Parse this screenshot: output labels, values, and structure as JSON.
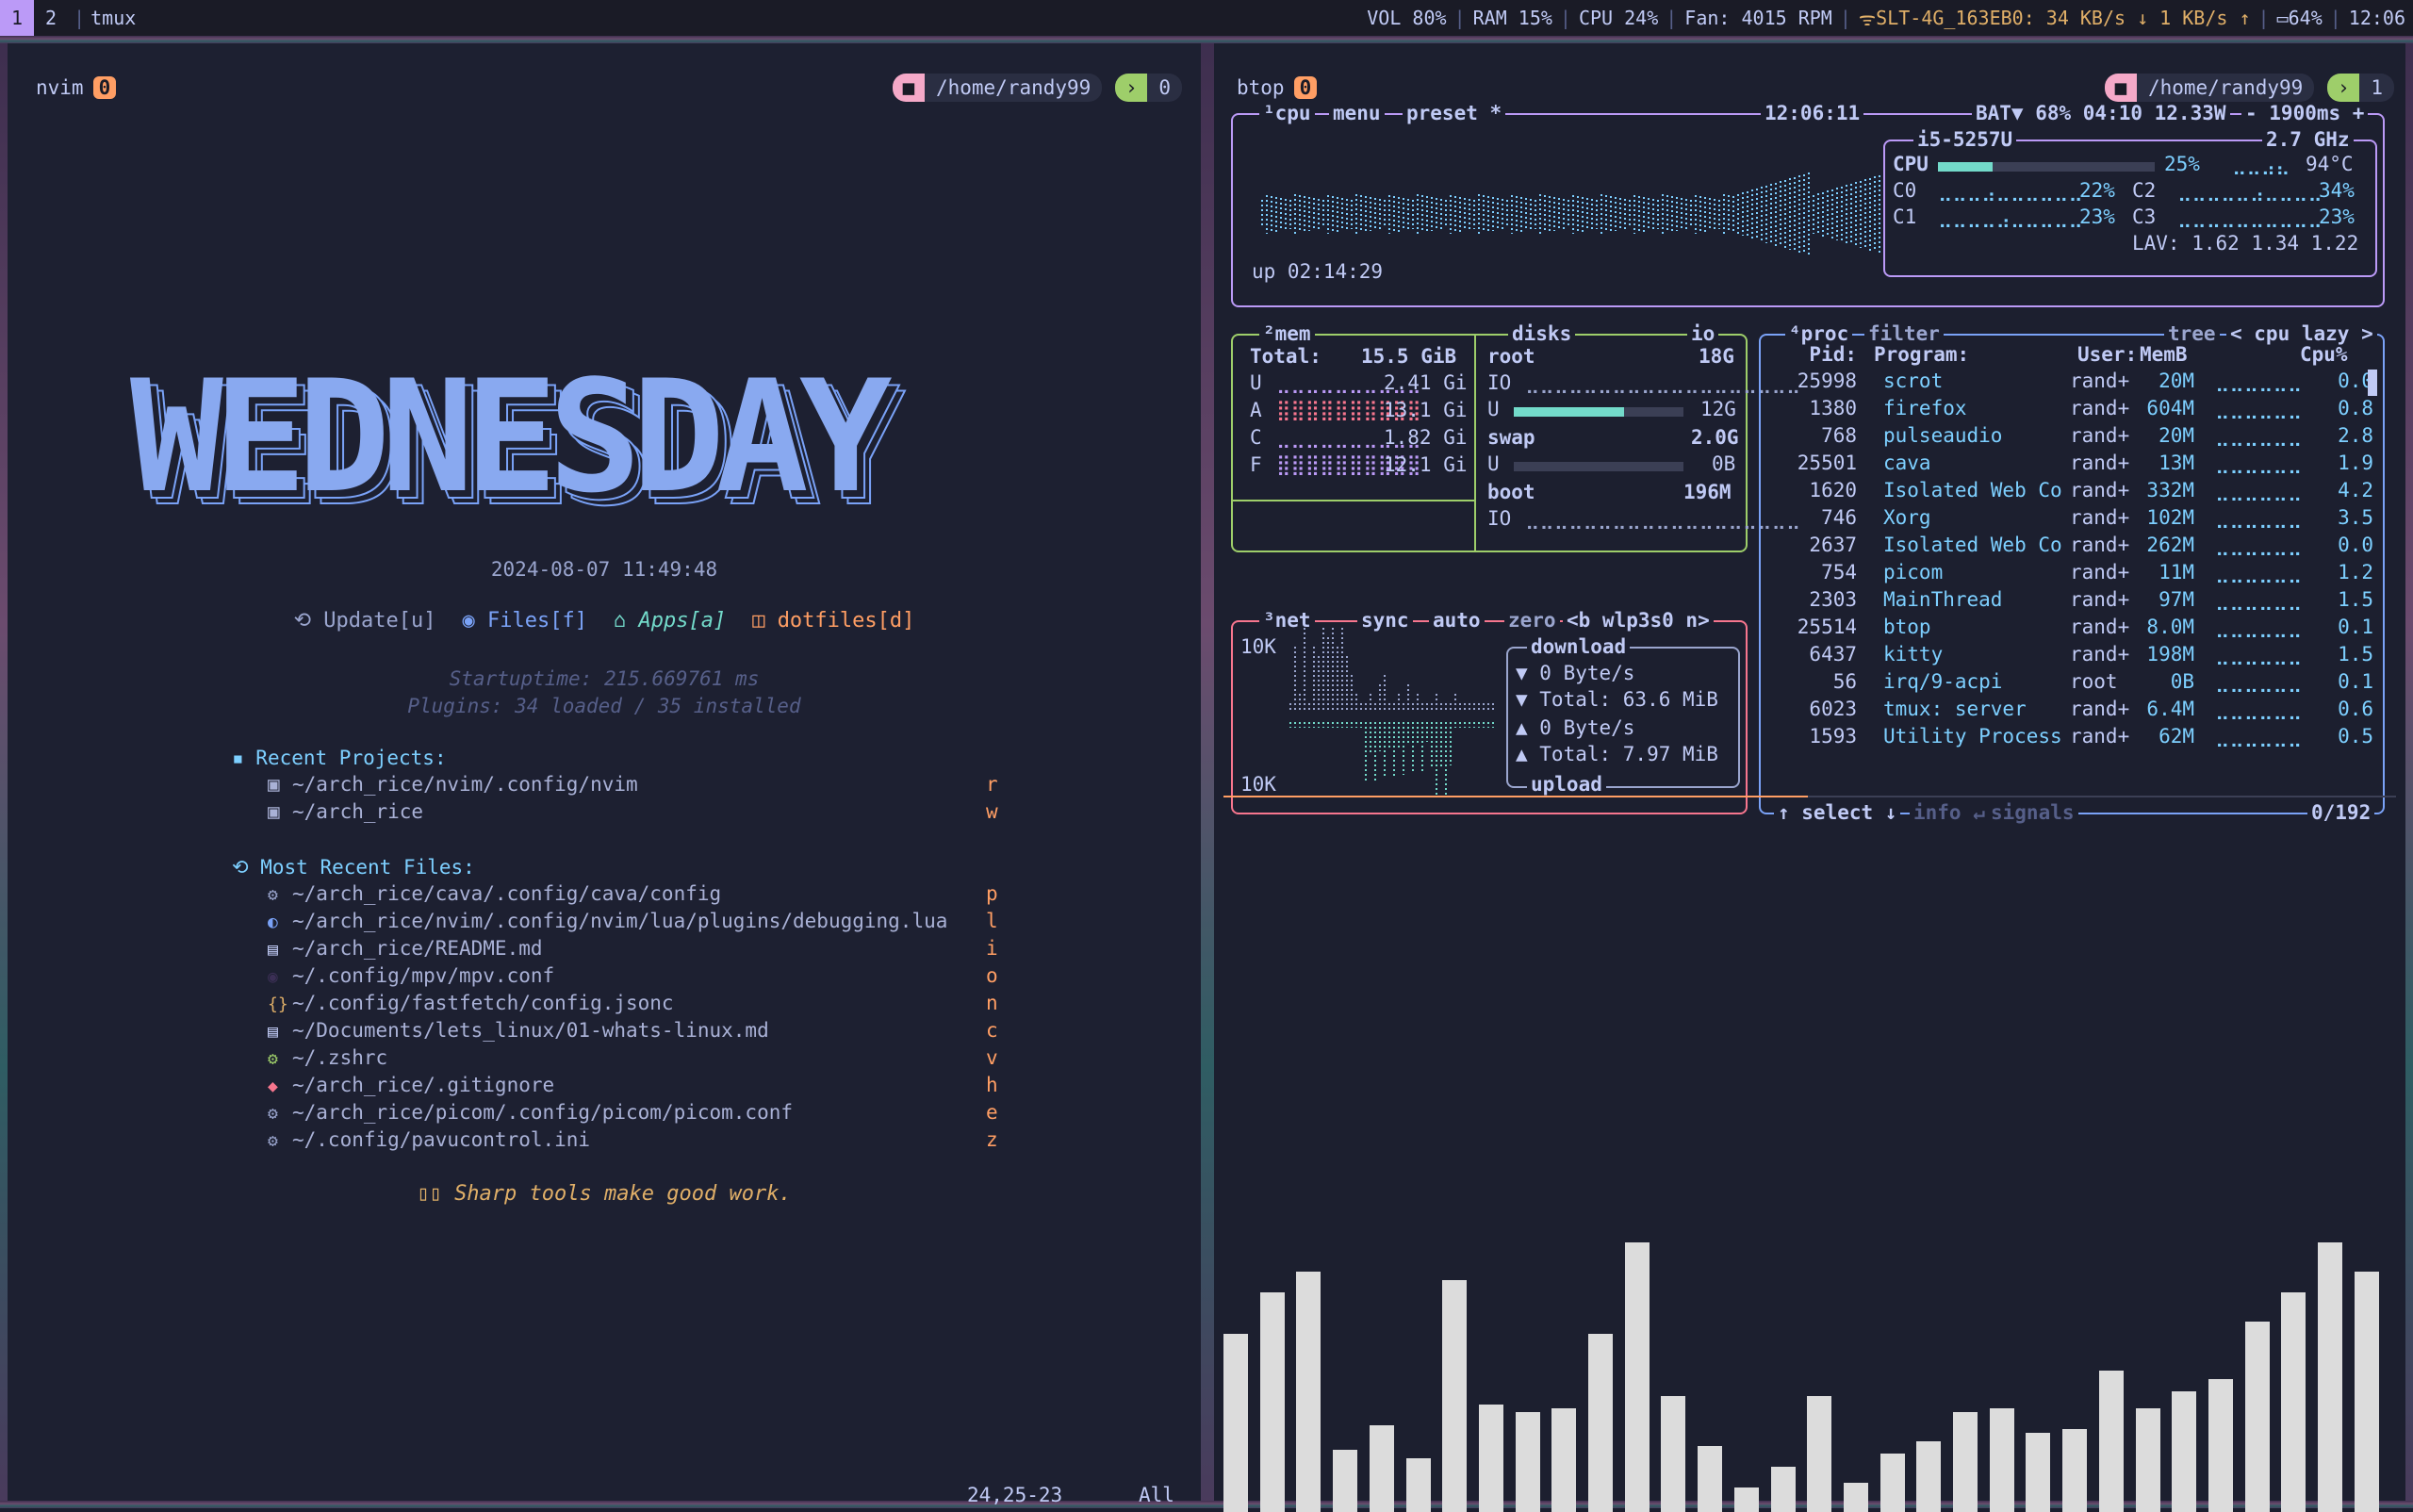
{
  "topbar": {
    "workspaces": [
      "1",
      "2"
    ],
    "session": "tmux",
    "status": [
      "VOL 80%",
      "RAM 15%",
      "CPU 24%",
      "Fan: 4015 RPM"
    ],
    "wifi": "SLT-4G_163EB0: 34 KB/s ↓ 1 KB/s ↑",
    "battery": "64%",
    "clock": "12:06"
  },
  "left": {
    "app": "nvim",
    "app_count": "0",
    "cwd": "/home/randy99",
    "term_count": "0",
    "banner": "WEDNESDAY",
    "datetime": "2024-08-07 11:49:48",
    "actions": [
      "Update[u]",
      "Files[f]",
      "Apps[a]",
      "dotfiles[d]"
    ],
    "startup": "Startuptime: 215.669761 ms",
    "plugins": "Plugins: 34 loaded / 35 installed",
    "projects_title": "Recent Projects:",
    "projects": [
      {
        "path": "~/arch_rice/nvim/.config/nvim",
        "key": "r"
      },
      {
        "path": "~/arch_rice",
        "key": "w"
      }
    ],
    "files_title": "Most Recent Files:",
    "files": [
      {
        "path": "~/arch_rice/cava/.config/cava/config",
        "key": "p",
        "icon": "gear-icon"
      },
      {
        "path": "~/arch_rice/nvim/.config/nvim/lua/plugins/debugging.lua",
        "key": "l",
        "icon": "lua-icon"
      },
      {
        "path": "~/arch_rice/README.md",
        "key": "i",
        "icon": "markdown-icon"
      },
      {
        "path": "~/.config/mpv/mpv.conf",
        "key": "o",
        "icon": "mpv-icon"
      },
      {
        "path": "~/.config/fastfetch/config.jsonc",
        "key": "n",
        "icon": "json-icon"
      },
      {
        "path": "~/Documents/lets_linux/01-whats-linux.md",
        "key": "c",
        "icon": "markdown-icon"
      },
      {
        "path": "~/.zshrc",
        "key": "v",
        "icon": "gear-icon"
      },
      {
        "path": "~/arch_rice/.gitignore",
        "key": "h",
        "icon": "git-icon"
      },
      {
        "path": "~/arch_rice/picom/.config/picom/picom.conf",
        "key": "e",
        "icon": "gear-icon"
      },
      {
        "path": "~/.config/pavucontrol.ini",
        "key": "z",
        "icon": "gear-icon"
      }
    ],
    "quote": "Sharp tools make good work.",
    "cursor_pos": "24,25-23",
    "scroll": "All"
  },
  "right": {
    "app": "btop",
    "app_count": "0",
    "cwd": "/home/randy99",
    "term_count": "1",
    "cpu_box": {
      "labels": [
        "¹cpu",
        "menu",
        "preset *"
      ],
      "time": "12:06:11",
      "battery": "BAT▼ 68% 04:10 12.33W",
      "refresh": "- 1900ms +",
      "model": "i5-5257U",
      "freq": "2.7 GHz",
      "uptime": "up 02:14:29",
      "cpu_total": "25%",
      "cpu_total_fill": 0.25,
      "temp": "94°C",
      "cores": [
        {
          "name": "C0",
          "pct": "22%"
        },
        {
          "name": "C1",
          "pct": "23%"
        },
        {
          "name": "C2",
          "pct": "34%"
        },
        {
          "name": "C3",
          "pct": "23%"
        }
      ],
      "lav": "LAV: 1.62 1.34 1.22"
    },
    "mem_box": {
      "label": "²mem",
      "total_label": "Total:",
      "total": "15.5 GiB",
      "rows": [
        {
          "k": "U",
          "v": "2.41 Gi"
        },
        {
          "k": "A",
          "v": "13.1 Gi"
        },
        {
          "k": "C",
          "v": "1.82 Gi"
        },
        {
          "k": "F",
          "v": "12.1 Gi"
        }
      ],
      "disks_label": "disks",
      "io_label": "io",
      "root": "root",
      "root_size": "18G",
      "io": "IO",
      "u": "U",
      "root_used": "12G",
      "root_fill": 0.65,
      "swap": "swap",
      "swap_size": "2.0G",
      "swap_used": "0B",
      "boot": "boot",
      "boot_size": "196M"
    },
    "net_box": {
      "labels": [
        "³net",
        "sync",
        "auto",
        "zero",
        "<b wlp3s0 n>"
      ],
      "top": "10K",
      "bottom": "10K",
      "download": "download",
      "dl_rate": "▼ 0 Byte/s",
      "dl_total": "▼ Total: 63.6 MiB",
      "ul_rate": "▲ 0 Byte/s",
      "ul_total": "▲ Total: 7.97 MiB",
      "upload": "upload"
    },
    "proc_box": {
      "labels": [
        "⁴proc",
        "filter",
        "tree",
        "< cpu lazy >"
      ],
      "headers": [
        "Pid:",
        "Program:",
        "User:",
        "MemB",
        "Cpu%"
      ],
      "rows": [
        [
          "25998",
          "scrot",
          "rand+",
          "20M",
          "0.0"
        ],
        [
          "1380",
          "firefox",
          "rand+",
          "604M",
          "0.8"
        ],
        [
          "768",
          "pulseaudio",
          "rand+",
          "20M",
          "2.8"
        ],
        [
          "25501",
          "cava",
          "rand+",
          "13M",
          "1.9"
        ],
        [
          "1620",
          "Isolated Web Co",
          "rand+",
          "332M",
          "4.2"
        ],
        [
          "746",
          "Xorg",
          "rand+",
          "102M",
          "3.5"
        ],
        [
          "2637",
          "Isolated Web Co",
          "rand+",
          "262M",
          "0.0"
        ],
        [
          "754",
          "picom",
          "rand+",
          "11M",
          "1.2"
        ],
        [
          "2303",
          "MainThread",
          "rand+",
          "97M",
          "1.5"
        ],
        [
          "25514",
          "btop",
          "rand+",
          "8.0M",
          "0.1"
        ],
        [
          "6437",
          "kitty",
          "rand+",
          "198M",
          "1.5"
        ],
        [
          "56",
          "irq/9-acpi",
          "root",
          "0B",
          "0.1"
        ],
        [
          "6023",
          "tmux: server",
          "rand+",
          "6.4M",
          "0.6"
        ],
        [
          "1593",
          "Utility Process",
          "rand+",
          "62M",
          "0.5"
        ]
      ],
      "footer_select": "↑ select ↓",
      "footer_info": "info ↵",
      "footer_signals": "signals",
      "count": "0/192"
    },
    "cava_levels": [
      0.43,
      0.53,
      0.58,
      0.15,
      0.21,
      0.13,
      0.56,
      0.26,
      0.24,
      0.25,
      0.43,
      0.65,
      0.28,
      0.16,
      0.06,
      0.11,
      0.28,
      0.07,
      0.14,
      0.17,
      0.24,
      0.25,
      0.19,
      0.2,
      0.34,
      0.25,
      0.29,
      0.32,
      0.46,
      0.53,
      0.65,
      0.58
    ]
  }
}
